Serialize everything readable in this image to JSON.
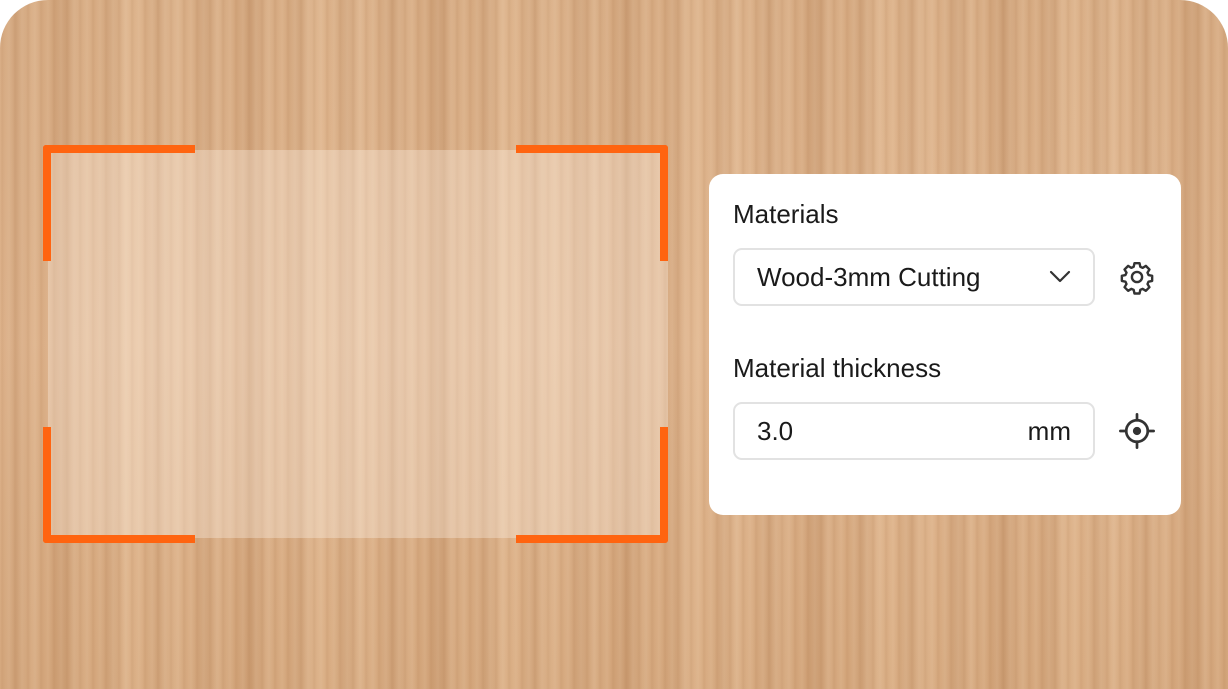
{
  "materials": {
    "label": "Materials",
    "selected": "Wood-3mm Cutting",
    "dropdown_icon": "chevron-down-icon",
    "settings_icon": "gear-icon"
  },
  "thickness": {
    "label": "Material thickness",
    "value": "3.0",
    "unit": "mm",
    "measure_icon": "crosshair-icon"
  },
  "colors": {
    "frame_accent": "#ff6410",
    "panel_bg": "#ffffff",
    "text": "#1a1a1a"
  }
}
